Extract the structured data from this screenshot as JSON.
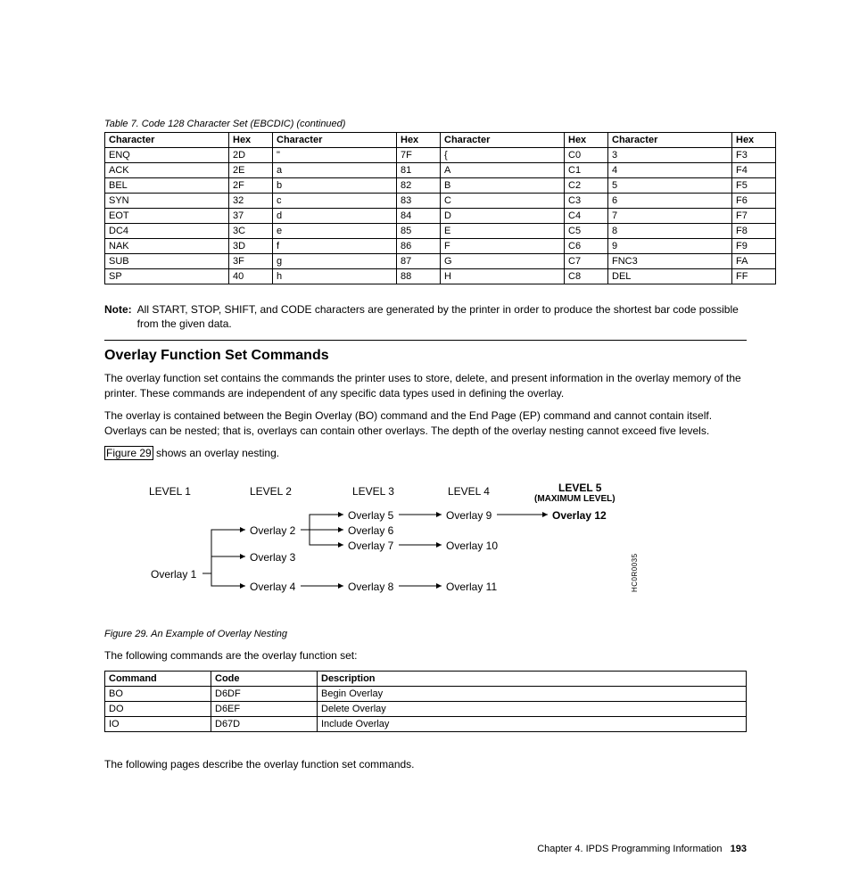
{
  "table1_caption": "Table 7. Code 128 Character Set (EBCDIC)  (continued)",
  "table1_headers": [
    "Character",
    "Hex",
    "Character",
    "Hex",
    "Character",
    "Hex",
    "Character",
    "Hex"
  ],
  "table1_rows": [
    [
      "ENQ",
      "2D",
      "\"",
      "7F",
      "{",
      "C0",
      "3",
      "F3"
    ],
    [
      "ACK",
      "2E",
      "a",
      "81",
      "A",
      "C1",
      "4",
      "F4"
    ],
    [
      "BEL",
      "2F",
      "b",
      "82",
      "B",
      "C2",
      "5",
      "F5"
    ],
    [
      "SYN",
      "32",
      "c",
      "83",
      "C",
      "C3",
      "6",
      "F6"
    ],
    [
      "EOT",
      "37",
      "d",
      "84",
      "D",
      "C4",
      "7",
      "F7"
    ],
    [
      "DC4",
      "3C",
      "e",
      "85",
      "E",
      "C5",
      "8",
      "F8"
    ],
    [
      "NAK",
      "3D",
      "f",
      "86",
      "F",
      "C6",
      "9",
      "F9"
    ],
    [
      "SUB",
      "3F",
      "g",
      "87",
      "G",
      "C7",
      "FNC3",
      "FA"
    ],
    [
      "SP",
      "40",
      "h",
      "88",
      "H",
      "C8",
      "DEL",
      "FF"
    ]
  ],
  "note_label": "Note:",
  "note_text": "All START, STOP, SHIFT, and CODE characters are generated by the printer in order to produce the shortest bar code possible from the given data.",
  "section_heading": "Overlay Function Set Commands",
  "p1": "The overlay function set contains the commands the printer uses to store, delete, and present information in the overlay memory of the printer. These commands are independent of any specific data types used in defining the overlay.",
  "p2": "The overlay is contained between the Begin Overlay (BO) command and the End Page (EP) command and cannot contain itself. Overlays can be nested; that is, overlays can contain other overlays. The depth of the overlay nesting cannot exceed five levels.",
  "figref_text": "Figure 29",
  "p3_suffix": " shows an overlay nesting.",
  "levels": {
    "l1": "LEVEL 1",
    "l2": "LEVEL 2",
    "l3": "LEVEL 3",
    "l4": "LEVEL 4",
    "l5": "LEVEL 5",
    "max": "(MAXIMUM LEVEL)"
  },
  "overlays": {
    "o1": "Overlay 1",
    "o2": "Overlay 2",
    "o3": "Overlay 3",
    "o4": "Overlay 4",
    "o5": "Overlay 5",
    "o6": "Overlay 6",
    "o7": "Overlay 7",
    "o8": "Overlay 8",
    "o9": "Overlay 9",
    "o10": "Overlay 10",
    "o11": "Overlay 11",
    "o12": "Overlay 12"
  },
  "diagram_code": "HC0R0035",
  "fig_caption": "Figure 29. An Example of Overlay Nesting",
  "p4": "The following commands are the overlay function set:",
  "table2_headers": [
    "Command",
    "Code",
    "Description"
  ],
  "table2_rows": [
    [
      "BO",
      "D6DF",
      "Begin Overlay"
    ],
    [
      "DO",
      "D6EF",
      "Delete Overlay"
    ],
    [
      "IO",
      "D67D",
      "Include Overlay"
    ]
  ],
  "p5": "The following pages describe the overlay function set commands.",
  "footer_chapter": "Chapter 4. IPDS Programming Information",
  "footer_page": "193"
}
